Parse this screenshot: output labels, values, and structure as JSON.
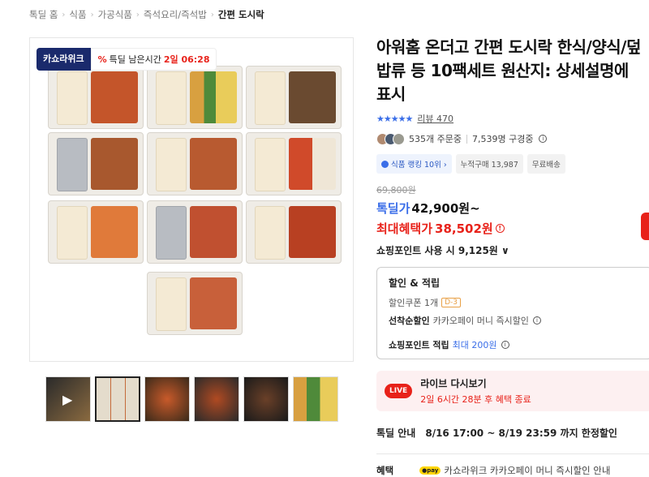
{
  "breadcrumb": [
    "톡딜 홈",
    "식품",
    "가공식품",
    "즉석요리/즉석밥",
    "간편 도시락"
  ],
  "image": {
    "kakao_tag": "카쇼라위크",
    "time_prefix": "특딜 남은시간",
    "time_value": "2일 06:28",
    "percent_icon": "%"
  },
  "product": {
    "title": "아워홈 온더고 간편 도시락 한식/양식/덮밥류 등 10팩세트 원산지: 상세설명에 표시",
    "stars": "★★★★★",
    "review": "리뷰 470",
    "orders": "535개 주문중",
    "buyers": "7,539명 구경중"
  },
  "chips": [
    "식품 랭킹 10위 ›",
    "누적구매 13,987",
    "무료배송"
  ],
  "price": {
    "original": "69,800원",
    "label": "톡딜가",
    "value": "42,900원~",
    "max_label": "최대혜택가",
    "max_value": "38,502원"
  },
  "points": "쇼핑포인트 사용 시 9,125원 ∨",
  "discount_box": {
    "title": "할인 & 적립",
    "coupon": "할인쿠폰 1개",
    "dtag": "D-3",
    "first": "선착순할인",
    "first_desc": "카카오페이 머니 즉시할인",
    "point_label": "쇼핑포인트 적립",
    "point_max": "최대 200원"
  },
  "live": {
    "badge": "LIVE",
    "title": "라이브 다시보기",
    "desc": "2일 6시간 28분 후 혜택 종료"
  },
  "notice": {
    "label": "톡딜 안내",
    "text": "8/16 17:00 ~ 8/19 23:59 까지 한정할인"
  },
  "benefit": {
    "label": "혜택",
    "pay": "●pay",
    "text": "카쇼라위크 카카오페이 머니 즉시할인 안내"
  },
  "colors": {
    "accent": "#3a6ee8",
    "sale": "#e8221a",
    "navy": "#1a2a6c"
  }
}
